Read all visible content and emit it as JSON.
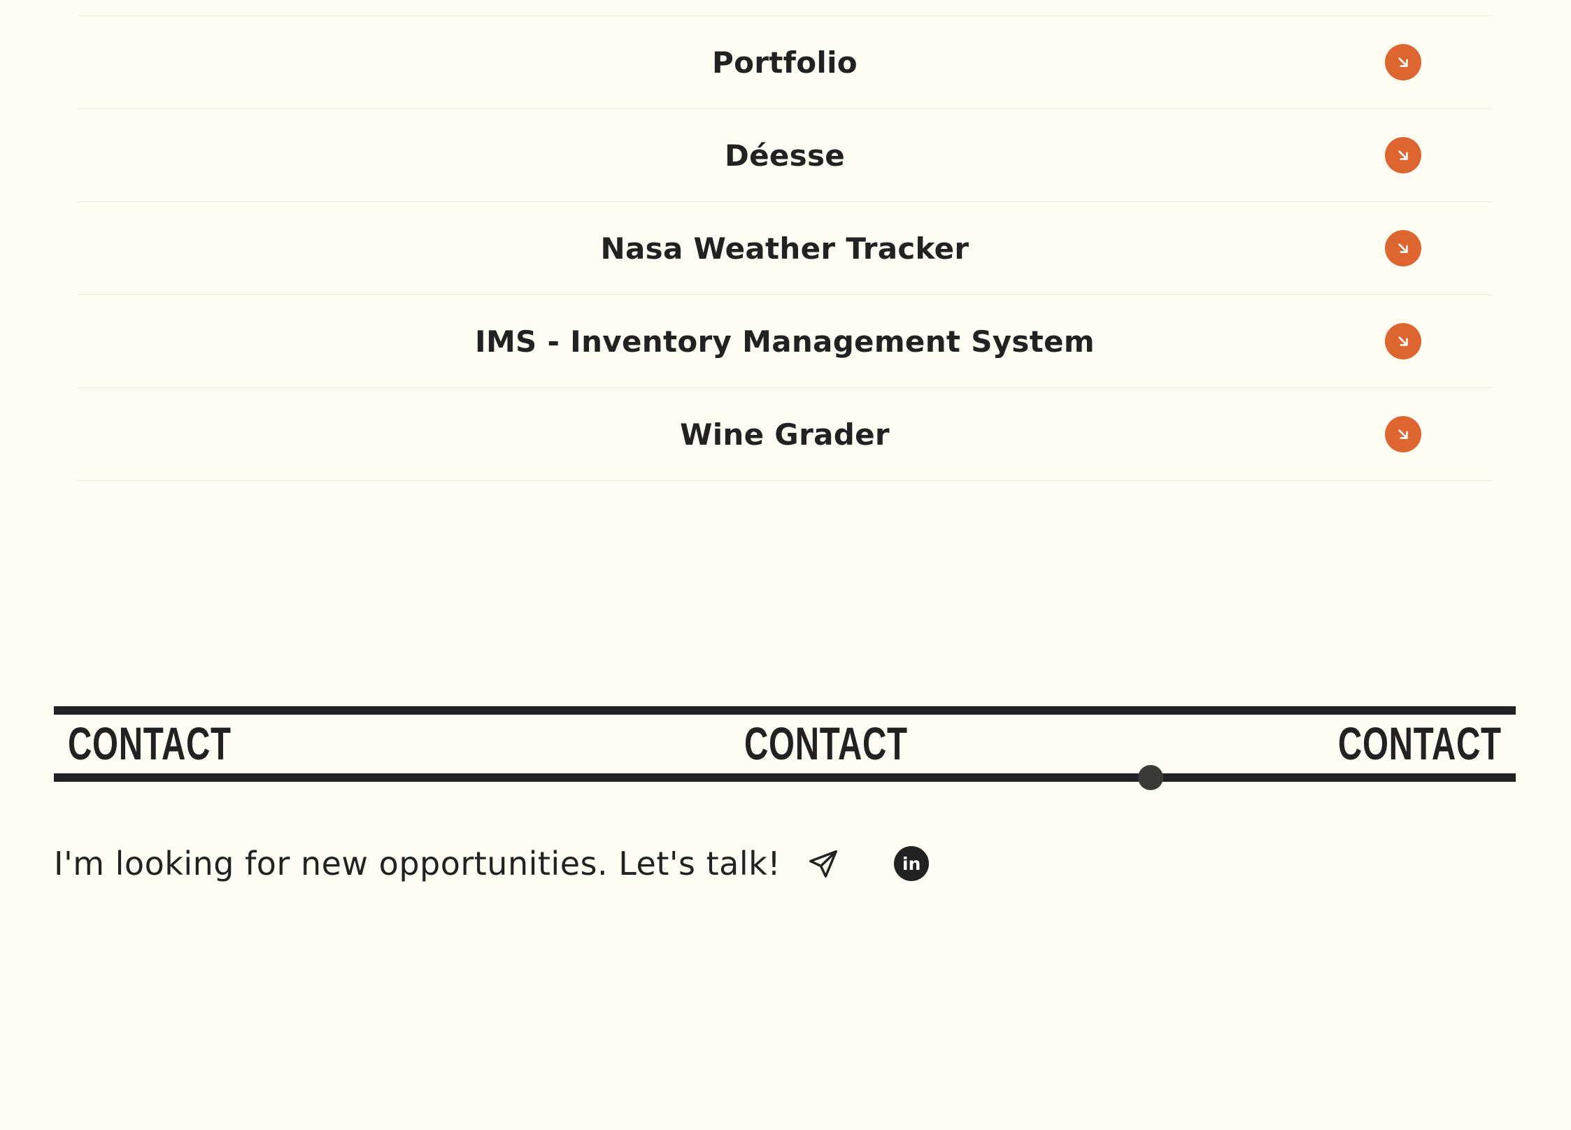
{
  "projects": {
    "items": [
      {
        "title": "Portfolio",
        "icon": "arrow-down-right-icon"
      },
      {
        "title": "Déesse",
        "icon": "arrow-down-right-icon"
      },
      {
        "title": "Nasa Weather Tracker",
        "icon": "arrow-down-right-icon"
      },
      {
        "title": "IMS - Inventory Management System",
        "icon": "arrow-down-right-icon"
      },
      {
        "title": "Wine Grader",
        "icon": "arrow-down-right-icon"
      }
    ]
  },
  "contact_band": {
    "words": [
      "CONTACT",
      "CONTACT",
      "CONTACT"
    ]
  },
  "contact": {
    "message": "I'm looking for new opportunities. Let's talk!",
    "send_icon": "paper-plane-icon",
    "linkedin_label": "in",
    "linkedin_icon": "linkedin-icon"
  },
  "colors": {
    "background": "#fefcf3",
    "text": "#222222",
    "accent": "#dc6530",
    "divider": "#ece9de"
  }
}
